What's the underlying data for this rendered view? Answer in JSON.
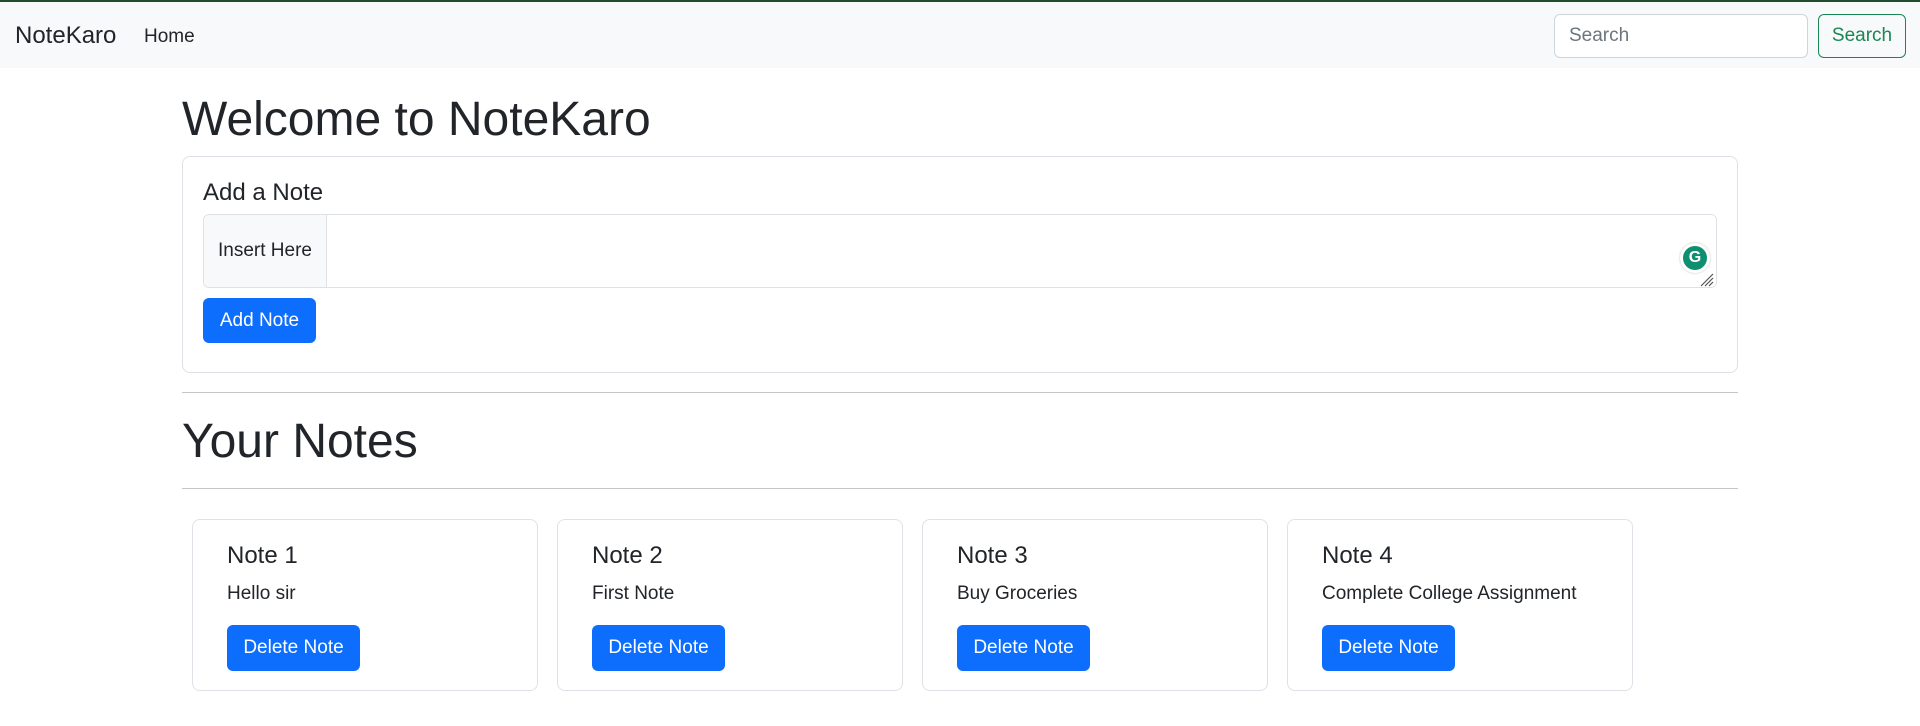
{
  "navbar": {
    "brand": "NoteKaro",
    "home_label": "Home",
    "search_placeholder": "Search",
    "search_value": "",
    "search_button_label": "Search"
  },
  "main": {
    "heading": "Welcome to NoteKaro",
    "add_card": {
      "title": "Add a Note",
      "input_label": "Insert Here",
      "textarea_value": "",
      "add_button_label": "Add Note"
    },
    "notes_heading": "Your Notes",
    "notes": [
      {
        "title": "Note 1",
        "text": "Hello sir",
        "delete_label": "Delete Note"
      },
      {
        "title": "Note 2",
        "text": "First Note",
        "delete_label": "Delete Note"
      },
      {
        "title": "Note 3",
        "text": "Buy Groceries",
        "delete_label": "Delete Note"
      },
      {
        "title": "Note 4",
        "text": "Complete College Assignment",
        "delete_label": "Delete Note"
      }
    ]
  },
  "icons": {
    "grammarly": "grammarly-icon",
    "resize": "resize-handle-icon"
  },
  "colors": {
    "primary": "#0d6efd",
    "success": "#198754",
    "navbar_bg": "#f8f9fa"
  }
}
